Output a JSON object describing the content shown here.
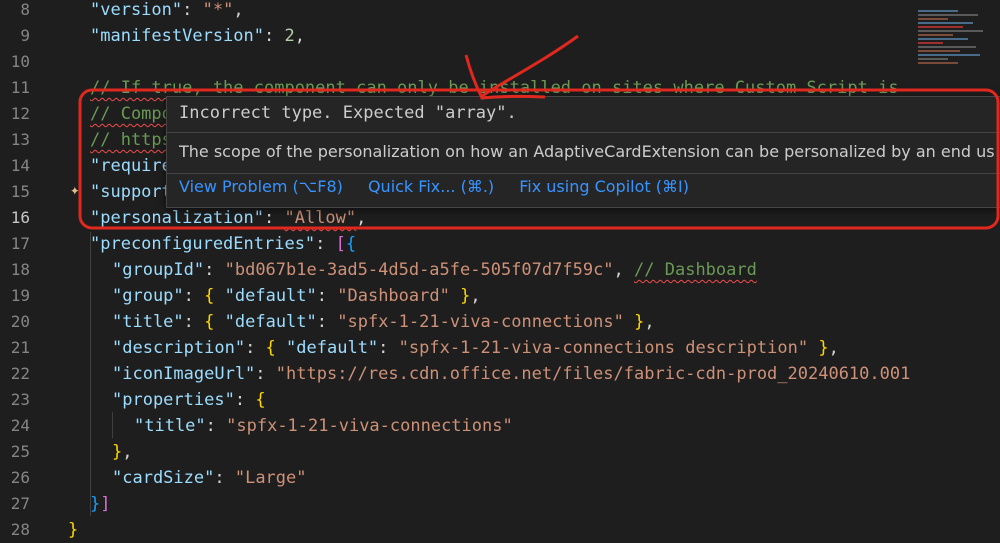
{
  "editor": {
    "lines": [
      {
        "num": "8",
        "tokens": [
          [
            "k",
            "\"version\""
          ],
          [
            "p",
            ": "
          ],
          [
            "s",
            "\"*\""
          ],
          [
            "p",
            ","
          ]
        ]
      },
      {
        "num": "9",
        "tokens": [
          [
            "k",
            "\"manifestVersion\""
          ],
          [
            "p",
            ": "
          ],
          [
            "n",
            "2"
          ],
          [
            "p",
            ","
          ]
        ]
      },
      {
        "num": "10",
        "tokens": []
      },
      {
        "num": "11",
        "tokens": [
          [
            "c",
            "// If true, the component can only be installed on sites where Custom Script is"
          ]
        ]
      },
      {
        "num": "12",
        "tokens": [
          [
            "c",
            "// Compo"
          ]
        ]
      },
      {
        "num": "13",
        "tokens": [
          [
            "c",
            "// https"
          ]
        ]
      },
      {
        "num": "14",
        "tokens": [
          [
            "k",
            "\"require"
          ]
        ]
      },
      {
        "num": "15",
        "tokens": [
          [
            "k",
            "\"support"
          ]
        ]
      },
      {
        "num": "16",
        "tokens": [
          [
            "k",
            "\"personalization\""
          ],
          [
            "p",
            ": "
          ],
          [
            "s",
            "\"Allow\""
          ],
          [
            "p",
            ","
          ]
        ]
      },
      {
        "num": "17",
        "tokens": [
          [
            "k",
            "\"preconfiguredEntries\""
          ],
          [
            "p",
            ": "
          ],
          [
            "b2",
            "["
          ],
          [
            "b3",
            "{"
          ]
        ]
      },
      {
        "num": "18",
        "tokens": [
          [
            "k",
            "\"groupId\""
          ],
          [
            "p",
            ": "
          ],
          [
            "s",
            "\"bd067b1e-3ad5-4d5d-a5fe-505f07d7f59c\""
          ],
          [
            "p",
            ", "
          ],
          [
            "c",
            "// Dashboard"
          ]
        ]
      },
      {
        "num": "19",
        "tokens": [
          [
            "k",
            "\"group\""
          ],
          [
            "p",
            ": "
          ],
          [
            "b1",
            "{"
          ],
          [
            "p",
            " "
          ],
          [
            "k",
            "\"default\""
          ],
          [
            "p",
            ": "
          ],
          [
            "s",
            "\"Dashboard\""
          ],
          [
            "p",
            " "
          ],
          [
            "b1",
            "}"
          ],
          [
            "p",
            ","
          ]
        ]
      },
      {
        "num": "20",
        "tokens": [
          [
            "k",
            "\"title\""
          ],
          [
            "p",
            ": "
          ],
          [
            "b1",
            "{"
          ],
          [
            "p",
            " "
          ],
          [
            "k",
            "\"default\""
          ],
          [
            "p",
            ": "
          ],
          [
            "s",
            "\"spfx-1-21-viva-connections\""
          ],
          [
            "p",
            " "
          ],
          [
            "b1",
            "}"
          ],
          [
            "p",
            ","
          ]
        ]
      },
      {
        "num": "21",
        "tokens": [
          [
            "k",
            "\"description\""
          ],
          [
            "p",
            ": "
          ],
          [
            "b1",
            "{"
          ],
          [
            "p",
            " "
          ],
          [
            "k",
            "\"default\""
          ],
          [
            "p",
            ": "
          ],
          [
            "s",
            "\"spfx-1-21-viva-connections description\""
          ],
          [
            "p",
            " "
          ],
          [
            "b1",
            "}"
          ],
          [
            "p",
            ","
          ]
        ]
      },
      {
        "num": "22",
        "tokens": [
          [
            "k",
            "\"iconImageUrl\""
          ],
          [
            "p",
            ": "
          ],
          [
            "s",
            "\"https://res.cdn.office.net/files/fabric-cdn-prod_20240610.001"
          ]
        ]
      },
      {
        "num": "23",
        "tokens": [
          [
            "k",
            "\"properties\""
          ],
          [
            "p",
            ": "
          ],
          [
            "b1",
            "{"
          ]
        ]
      },
      {
        "num": "24",
        "tokens": [
          [
            "k",
            "\"title\""
          ],
          [
            "p",
            ": "
          ],
          [
            "s",
            "\"spfx-1-21-viva-connections\""
          ]
        ]
      },
      {
        "num": "25",
        "tokens": [
          [
            "b1",
            "}"
          ],
          [
            "p",
            ","
          ]
        ]
      },
      {
        "num": "26",
        "tokens": [
          [
            "k",
            "\"cardSize\""
          ],
          [
            "p",
            ": "
          ],
          [
            "s",
            "\"Large\""
          ]
        ]
      },
      {
        "num": "27",
        "tokens": [
          [
            "b3",
            "}"
          ],
          [
            "b2",
            "]"
          ]
        ]
      },
      {
        "num": "28",
        "tokens": [
          [
            "b1",
            "}"
          ]
        ]
      }
    ],
    "active_line": "16"
  },
  "hover": {
    "title": "Incorrect type. Expected \"array\".",
    "description": "The scope of the personalization on how an AdaptiveCardExtension can be personalized by an end us",
    "actions": [
      "View Problem (⌥F8)",
      "Quick Fix... (⌘.)",
      "Fix using Copilot (⌘I)"
    ]
  },
  "colors": {
    "annotation": "#e0281e",
    "link": "#3794ff"
  },
  "icons": {
    "gutter_action": "sparkle-icon"
  }
}
